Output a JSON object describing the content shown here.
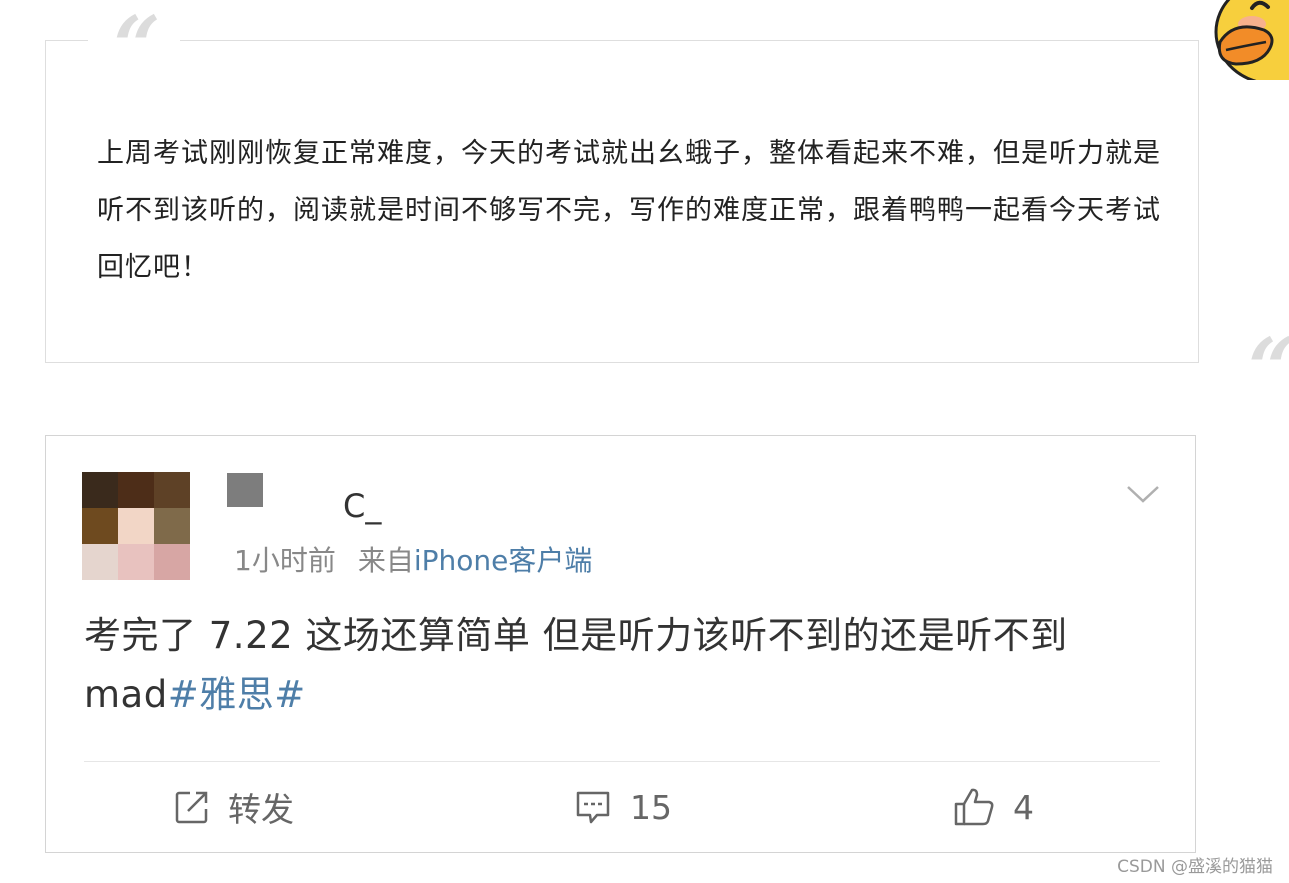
{
  "intro": {
    "quote_icon": "quote-icon",
    "text": "上周考试刚刚恢复正常难度，今天的考试就出幺蛾子，整体看起来不难，但是听力就是听不到该听的，阅读就是时间不够写不完，写作的难度正常，跟着鸭鸭一起看今天考试回忆吧！"
  },
  "mascot_icon": "duck-icon",
  "post": {
    "username_visible": "C_",
    "time": "1小时前",
    "source_prefix": "来自",
    "source_device": "iPhone客户端",
    "text": "考完了 7.22 这场还算简单 但是听力该听不到的还是听不到mad",
    "hashtag": "#雅思#",
    "actions": {
      "repost_label": "转发",
      "comment_count": "15",
      "like_count": "4"
    },
    "colors": {
      "link": "#4e7ea8",
      "text": "#333333",
      "meta": "#888888"
    }
  },
  "watermark": "CSDN @盛溪的猫猫"
}
